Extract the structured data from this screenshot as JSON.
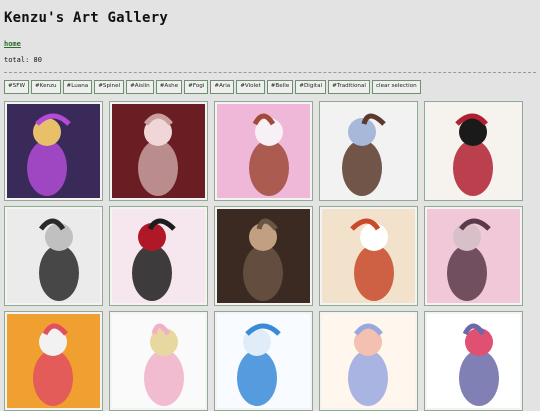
{
  "header": {
    "title": "Kenzu's Art Gallery"
  },
  "nav": {
    "home_label": "home"
  },
  "summary": {
    "total_text": "total: 80"
  },
  "tags": [
    "#SFW",
    "#Kenzu",
    "#Luana",
    "#Spinel",
    "#Aislin",
    "#Ashe",
    "#Fogi",
    "#Aria",
    "#Violet",
    "#Belle",
    "#Digital",
    "#Traditional",
    "clear selection"
  ],
  "gallery": [
    {
      "name": "thumb-purple-hair-character",
      "colors": [
        "#3a2a5a",
        "#b24bd6",
        "#e8c06a"
      ]
    },
    {
      "name": "thumb-reclining-figures",
      "colors": [
        "#6a1e24",
        "#c8a0a0",
        "#f0d6d6"
      ]
    },
    {
      "name": "thumb-two-furry-characters",
      "colors": [
        "#f0b8d8",
        "#a04a3a",
        "#f7f0f4"
      ]
    },
    {
      "name": "thumb-human-and-fox",
      "colors": [
        "#f2f2f2",
        "#5a3a2a",
        "#a8b8d8"
      ]
    },
    {
      "name": "thumb-red-black-character",
      "colors": [
        "#f6f2ee",
        "#b02030",
        "#1a1a1a"
      ]
    },
    {
      "name": "thumb-dark-hyena-character",
      "colors": [
        "#ebebeb",
        "#2a2a2a",
        "#c0c0c0"
      ]
    },
    {
      "name": "thumb-horned-red-hair-girl",
      "colors": [
        "#f6e6ee",
        "#1c1c1c",
        "#b01828"
      ]
    },
    {
      "name": "thumb-library-couple",
      "colors": [
        "#3a2a22",
        "#6a5444",
        "#c0a080"
      ]
    },
    {
      "name": "thumb-white-fox-sketch",
      "colors": [
        "#f2e2cc",
        "#c84a2a",
        "#ffffff"
      ]
    },
    {
      "name": "thumb-bedroom-scene",
      "colors": [
        "#f0c8d8",
        "#5a3a4a",
        "#d8c0c8"
      ]
    },
    {
      "name": "thumb-winged-sunset-girl",
      "colors": [
        "#f0a030",
        "#e05060",
        "#f2f2f2"
      ]
    },
    {
      "name": "thumb-pastel-sketch-girl",
      "colors": [
        "#fafafa",
        "#f0b0c8",
        "#e8d8a0"
      ]
    },
    {
      "name": "thumb-blue-glasses-sketch",
      "colors": [
        "#f8fbff",
        "#3a8ad8",
        "#e0ecf8"
      ]
    },
    {
      "name": "thumb-hugging-pair",
      "colors": [
        "#fff6ee",
        "#9aa8e0",
        "#f4c0b0"
      ]
    },
    {
      "name": "thumb-doodle-collage",
      "colors": [
        "#ffffff",
        "#6a6aa8",
        "#e05070"
      ]
    }
  ]
}
